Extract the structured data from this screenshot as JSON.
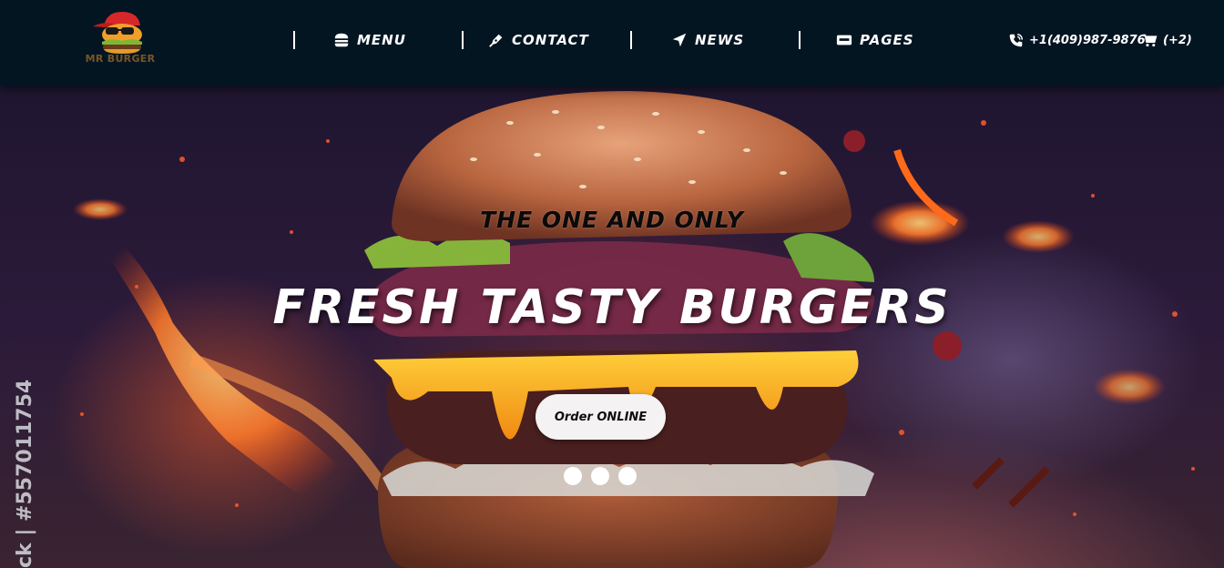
{
  "brand": {
    "name": "MR BURGER"
  },
  "nav": {
    "items": [
      {
        "label": "MENU",
        "icon": "burger-icon"
      },
      {
        "label": "CONTACT",
        "icon": "pen-icon"
      },
      {
        "label": "NEWS",
        "icon": "location-arrow-icon"
      },
      {
        "label": "PAGES",
        "icon": "card-icon"
      }
    ]
  },
  "header": {
    "phone": "+1(409)987-9876",
    "cart_count": "(+2)",
    "phone_icon": "phone-icon",
    "cart_icon": "cart-icon"
  },
  "hero": {
    "tagline": "THE ONE AND ONLY",
    "headline": "FRESH TASTY BURGERS",
    "cta_label": "Order ONLINE",
    "watermark": "ck | #557011754",
    "slides": 3
  },
  "colors": {
    "header_bg": "#041522",
    "text": "#ffffff",
    "button_bg": "#f4f2f2"
  }
}
